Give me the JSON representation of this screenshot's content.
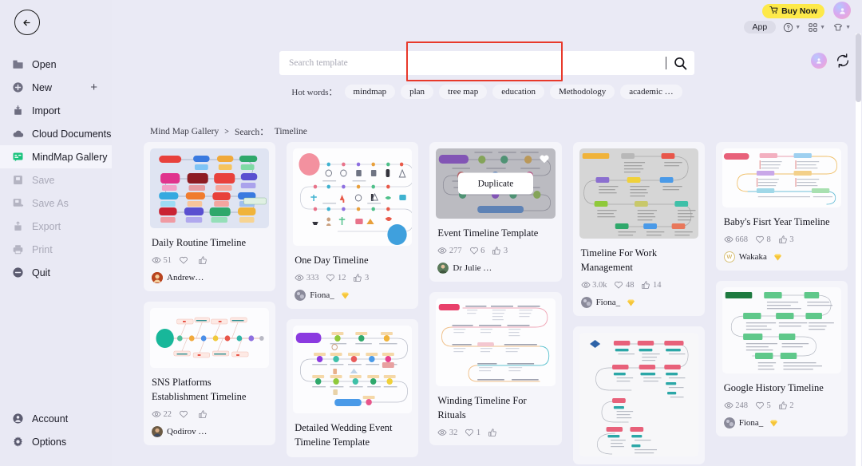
{
  "sidebar": {
    "back_icon": "arrow-left-circle-icon",
    "items": [
      {
        "label": "Open",
        "icon": "folder-icon",
        "state": "normal",
        "trailing": ""
      },
      {
        "label": "New",
        "icon": "plus-circle-icon",
        "state": "normal",
        "trailing": "+"
      },
      {
        "label": "Import",
        "icon": "import-icon",
        "state": "normal",
        "trailing": ""
      },
      {
        "label": "Cloud Documents",
        "icon": "cloud-icon",
        "state": "normal",
        "trailing": ""
      },
      {
        "label": "MindMap Gallery",
        "icon": "mindmap-icon",
        "state": "active",
        "trailing": ""
      },
      {
        "label": "Save",
        "icon": "save-icon",
        "state": "disabled",
        "trailing": ""
      },
      {
        "label": "Save As",
        "icon": "save-as-icon",
        "state": "disabled",
        "trailing": ""
      },
      {
        "label": "Export",
        "icon": "export-icon",
        "state": "disabled",
        "trailing": ""
      },
      {
        "label": "Print",
        "icon": "printer-icon",
        "state": "disabled",
        "trailing": ""
      },
      {
        "label": "Quit",
        "icon": "minus-circle-icon",
        "state": "normal",
        "trailing": ""
      }
    ],
    "bottom_items": [
      {
        "label": "Account",
        "icon": "user-circle-icon"
      },
      {
        "label": "Options",
        "icon": "gear-icon"
      }
    ]
  },
  "header": {
    "buy_now_label": "Buy Now",
    "buy_now_icon": "cart-icon",
    "buy_now_bg": "#fde949",
    "app_chip_label": "App",
    "help_icon": "question-circle-icon",
    "grid_icon": "grid-apps-icon",
    "shirt_icon": "theme-shirt-icon",
    "avatar_icon": "user-avatar"
  },
  "search": {
    "placeholder": "Search template",
    "value": "",
    "search_icon": "search-icon",
    "hot_words_label": "Hot words：",
    "hot_words": [
      "mindmap",
      "plan",
      "tree map",
      "education",
      "Methodology",
      "academic …"
    ],
    "side_avatar_icon": "user-avatar",
    "refresh_icon": "refresh-icon"
  },
  "breadcrumb": {
    "root": "Mind Map Gallery",
    "separator": ">",
    "label": "Search：",
    "query": "Timeline"
  },
  "overlay": {
    "duplicate_label": "Duplicate",
    "selection_color": "#e8392b",
    "favorite_icon": "heart-icon"
  },
  "gallery": {
    "columns": [
      [
        {
          "title": "Daily Routine Timeline",
          "views": "51",
          "likes": "",
          "thumbs": "",
          "author": "Andrew…",
          "author_initial": "A",
          "author_color": "#b8441f",
          "vip": false,
          "thumb_style": "grid-blue",
          "thumb_h": 100,
          "hovered": false
        },
        {
          "title": "SNS Platforms Establishment Timeline",
          "views": "22",
          "likes": "",
          "thumbs": "",
          "author": "Qodirov …",
          "author_initial": "Q",
          "author_color": "#6b5a44",
          "vip": false,
          "thumb_style": "fishbone",
          "thumb_h": 75,
          "hovered": false
        }
      ],
      [
        {
          "title": "One Day Timeline",
          "views": "333",
          "likes": "12",
          "thumbs": "3",
          "author": "Fiona_",
          "author_initial": "F",
          "author_color": "#7c7c8c",
          "vip": true,
          "thumb_style": "icon-rows",
          "thumb_h": 122,
          "hovered": false
        },
        {
          "title": "Detailed Wedding Event Timeline Template",
          "views": "",
          "likes": "",
          "thumbs": "",
          "author": "",
          "author_initial": "",
          "author_color": "#7c7c8c",
          "vip": false,
          "thumb_style": "wedding",
          "thumb_h": 110,
          "hovered": false
        }
      ],
      [
        {
          "title": "Event Timeline Template",
          "views": "277",
          "likes": "6",
          "thumbs": "3",
          "author": "Dr Julie …",
          "author_initial": "J",
          "author_color": "#4a6b4a",
          "vip": false,
          "thumb_style": "event-snake",
          "thumb_h": 88,
          "hovered": true
        },
        {
          "title": "Winding Timeline For Rituals",
          "views": "32",
          "likes": "1",
          "thumbs": "",
          "author": "",
          "author_initial": "",
          "author_color": "#7c7c8c",
          "vip": false,
          "thumb_style": "winding",
          "thumb_h": 110,
          "hovered": false
        }
      ],
      [
        {
          "title": "Timeline For Work Management",
          "views": "3.0k",
          "likes": "48",
          "thumbs": "14",
          "author": "Fiona_",
          "author_initial": "F",
          "author_color": "#7c7c8c",
          "vip": true,
          "thumb_style": "work-grey",
          "thumb_h": 113,
          "hovered": false
        },
        {
          "title": "",
          "views": "",
          "likes": "",
          "thumbs": "",
          "author": "",
          "author_initial": "",
          "author_color": "#7c7c8c",
          "vip": false,
          "thumb_style": "pink-tree",
          "thumb_h": 155,
          "hovered": false
        }
      ],
      [
        {
          "title": "Baby's Fisrt Year Timeline",
          "views": "668",
          "likes": "8",
          "thumbs": "3",
          "author": "Wakaka",
          "author_initial": "W",
          "author_color": "#c8a23c",
          "vip": true,
          "thumb_style": "baby",
          "thumb_h": 74,
          "hovered": false
        },
        {
          "title": "Google History Timeline",
          "views": "248",
          "likes": "5",
          "thumbs": "2",
          "author": "Fiona_",
          "author_initial": "F",
          "author_color": "#7c7c8c",
          "vip": true,
          "thumb_style": "green-tree",
          "thumb_h": 108,
          "hovered": false
        }
      ]
    ]
  }
}
